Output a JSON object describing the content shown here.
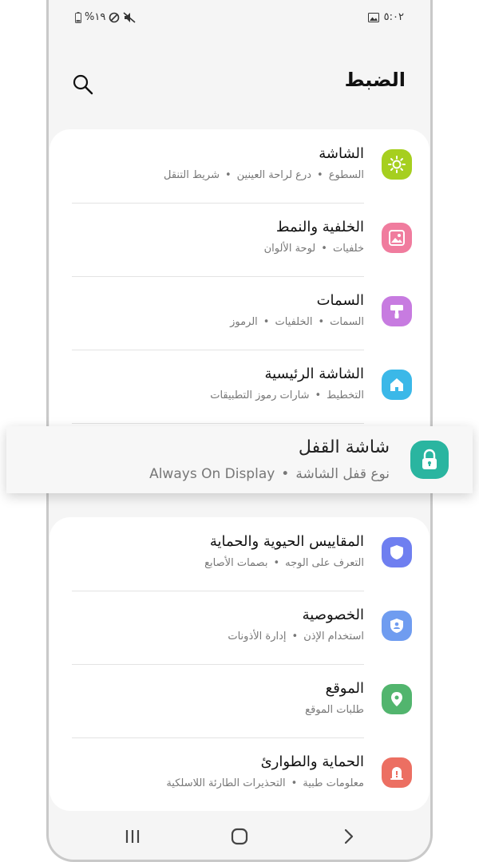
{
  "status_bar": {
    "battery": "%١٩",
    "time": "٥:٠٢"
  },
  "header": {
    "title": "الضبط"
  },
  "settings_group_1": [
    {
      "title": "الشاشة",
      "subtitle": [
        "السطوع",
        "درع لراحة العينين",
        "شريط التنقل"
      ],
      "icon": "sun-icon",
      "color": "#a6cf1f"
    },
    {
      "title": "الخلفية والنمط",
      "subtitle": [
        "خلفيات",
        "لوحة الألوان"
      ],
      "icon": "image-icon",
      "color": "#f07c9e"
    },
    {
      "title": "السمات",
      "subtitle": [
        "السمات",
        "الخلفيات",
        "الرموز"
      ],
      "icon": "paint-brush-icon",
      "color": "#c77be0"
    },
    {
      "title": "الشاشة الرئيسية",
      "subtitle": [
        "التخطيط",
        "شارات رموز التطبيقات"
      ],
      "icon": "home-icon",
      "color": "#3bb8e8"
    }
  ],
  "lock_screen": {
    "title": "شاشة القفل",
    "subtitle": [
      "نوع قفل الشاشة",
      "Always On Display"
    ],
    "icon": "lock-icon",
    "color": "#2ab5a0"
  },
  "settings_group_2": [
    {
      "title": "المقاييس الحيوية والحماية",
      "subtitle": [
        "التعرف على الوجه",
        "بصمات الأصابع"
      ],
      "icon": "shield-icon",
      "color": "#6f7ff0"
    },
    {
      "title": "الخصوصية",
      "subtitle": [
        "استخدام الإذن",
        "إدارة الأذونات"
      ],
      "icon": "privacy-shield-icon",
      "color": "#6f9cf0"
    },
    {
      "title": "الموقع",
      "subtitle": [
        "طلبات الموقع"
      ],
      "icon": "location-pin-icon",
      "color": "#52b56e"
    },
    {
      "title": "الحماية والطوارئ",
      "subtitle": [
        "معلومات طبية",
        "التحذيرات الطارئة اللاسلكية"
      ],
      "icon": "warning-icon",
      "color": "#ec6f62"
    }
  ]
}
